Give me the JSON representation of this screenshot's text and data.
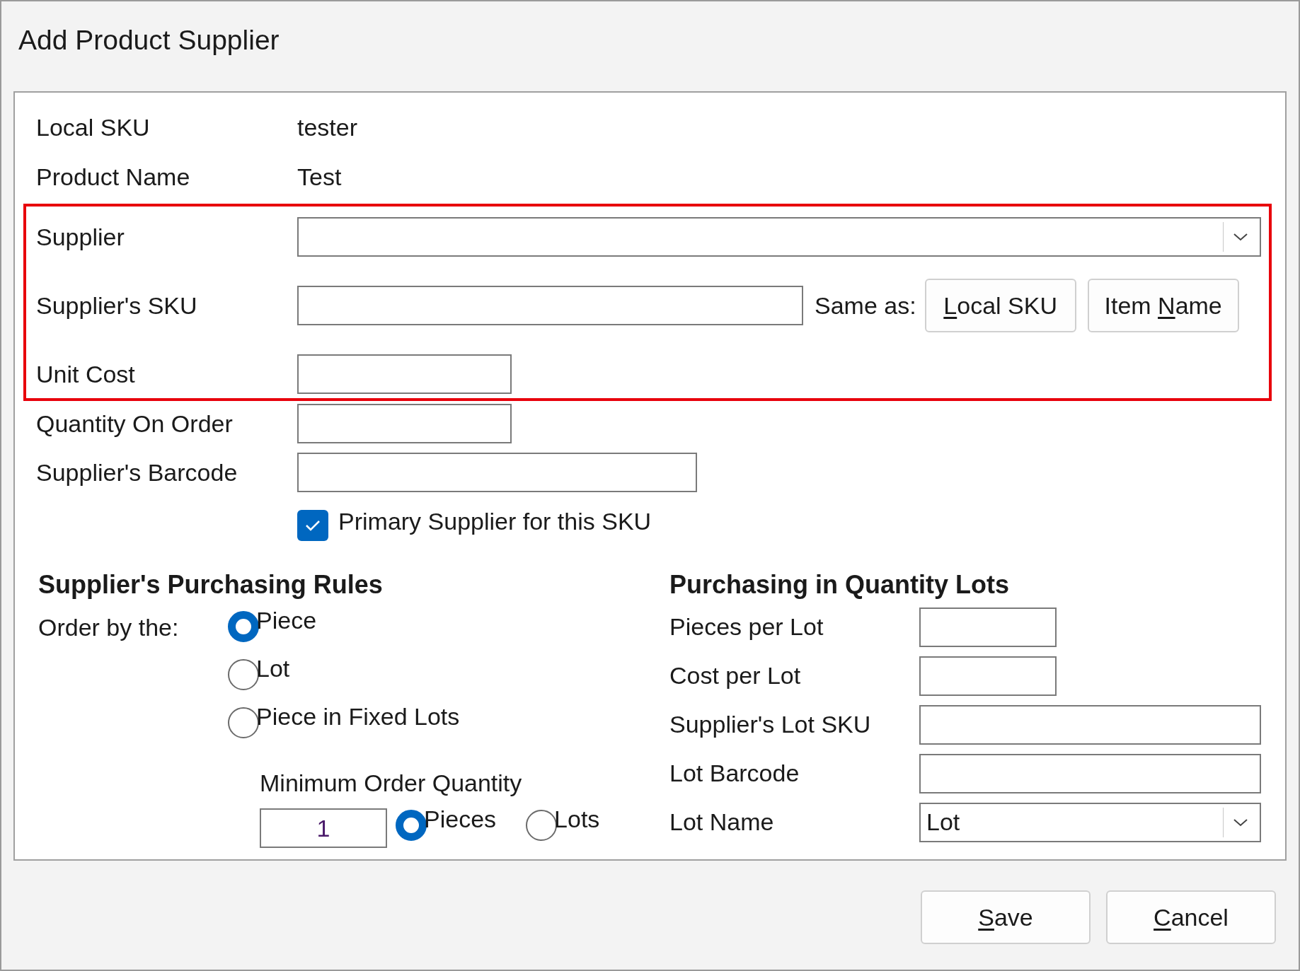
{
  "window": {
    "title": "Add Product Supplier"
  },
  "fields": [
    {
      "kind": "value",
      "label": "Local SKU",
      "value": "tester"
    },
    {
      "kind": "value",
      "label": "Product Name",
      "value": "Test"
    }
  ],
  "highlight_box": {
    "fields": [
      {
        "kind": "combo",
        "label": "Supplier"
      },
      {
        "kind": "sku",
        "label": "Supplier's SKU"
      },
      {
        "kind": "short",
        "label": "Unit Cost"
      }
    ]
  },
  "more_fields": [
    {
      "kind": "short",
      "label": "Quantity On Order"
    },
    {
      "kind": "medium",
      "label": "Supplier's Barcode"
    }
  ],
  "same_as": {
    "label": "Same as:",
    "buttons": [
      {
        "access_key": "L",
        "label_end": "ocal SKU"
      },
      {
        "label_start": "Item ",
        "access_key": "N",
        "label_end": "ame"
      }
    ]
  },
  "primary_checkbox": {
    "label": "Primary Supplier for this SKU",
    "checked": true
  },
  "purchasing_rules": {
    "title": "Supplier's Purchasing Rules",
    "order_by": "Order by the:",
    "options": [
      {
        "label": "Piece",
        "selected": true
      },
      {
        "label": "Lot",
        "selected": false
      },
      {
        "label": "Piece in Fixed Lots",
        "selected": false
      }
    ],
    "minimum": {
      "label": "Minimum Order Quantity",
      "value": "1",
      "units": [
        {
          "label": "Pieces",
          "selected": true
        },
        {
          "label": "Lots",
          "selected": false
        }
      ]
    }
  },
  "quantity_lots": {
    "title": "Purchasing in Quantity Lots",
    "fields": [
      {
        "kind": "short",
        "label": "Pieces per Lot"
      },
      {
        "kind": "short",
        "label": "Cost per Lot"
      },
      {
        "kind": "long",
        "label": "Supplier's Lot SKU"
      },
      {
        "kind": "long",
        "label": "Lot Barcode"
      },
      {
        "kind": "combo",
        "label": "Lot Name",
        "value": "Lot"
      }
    ]
  },
  "buttons": [
    {
      "access_key": "S",
      "label_end": "ave"
    },
    {
      "access_key": "C",
      "label_end": "ancel"
    }
  ]
}
